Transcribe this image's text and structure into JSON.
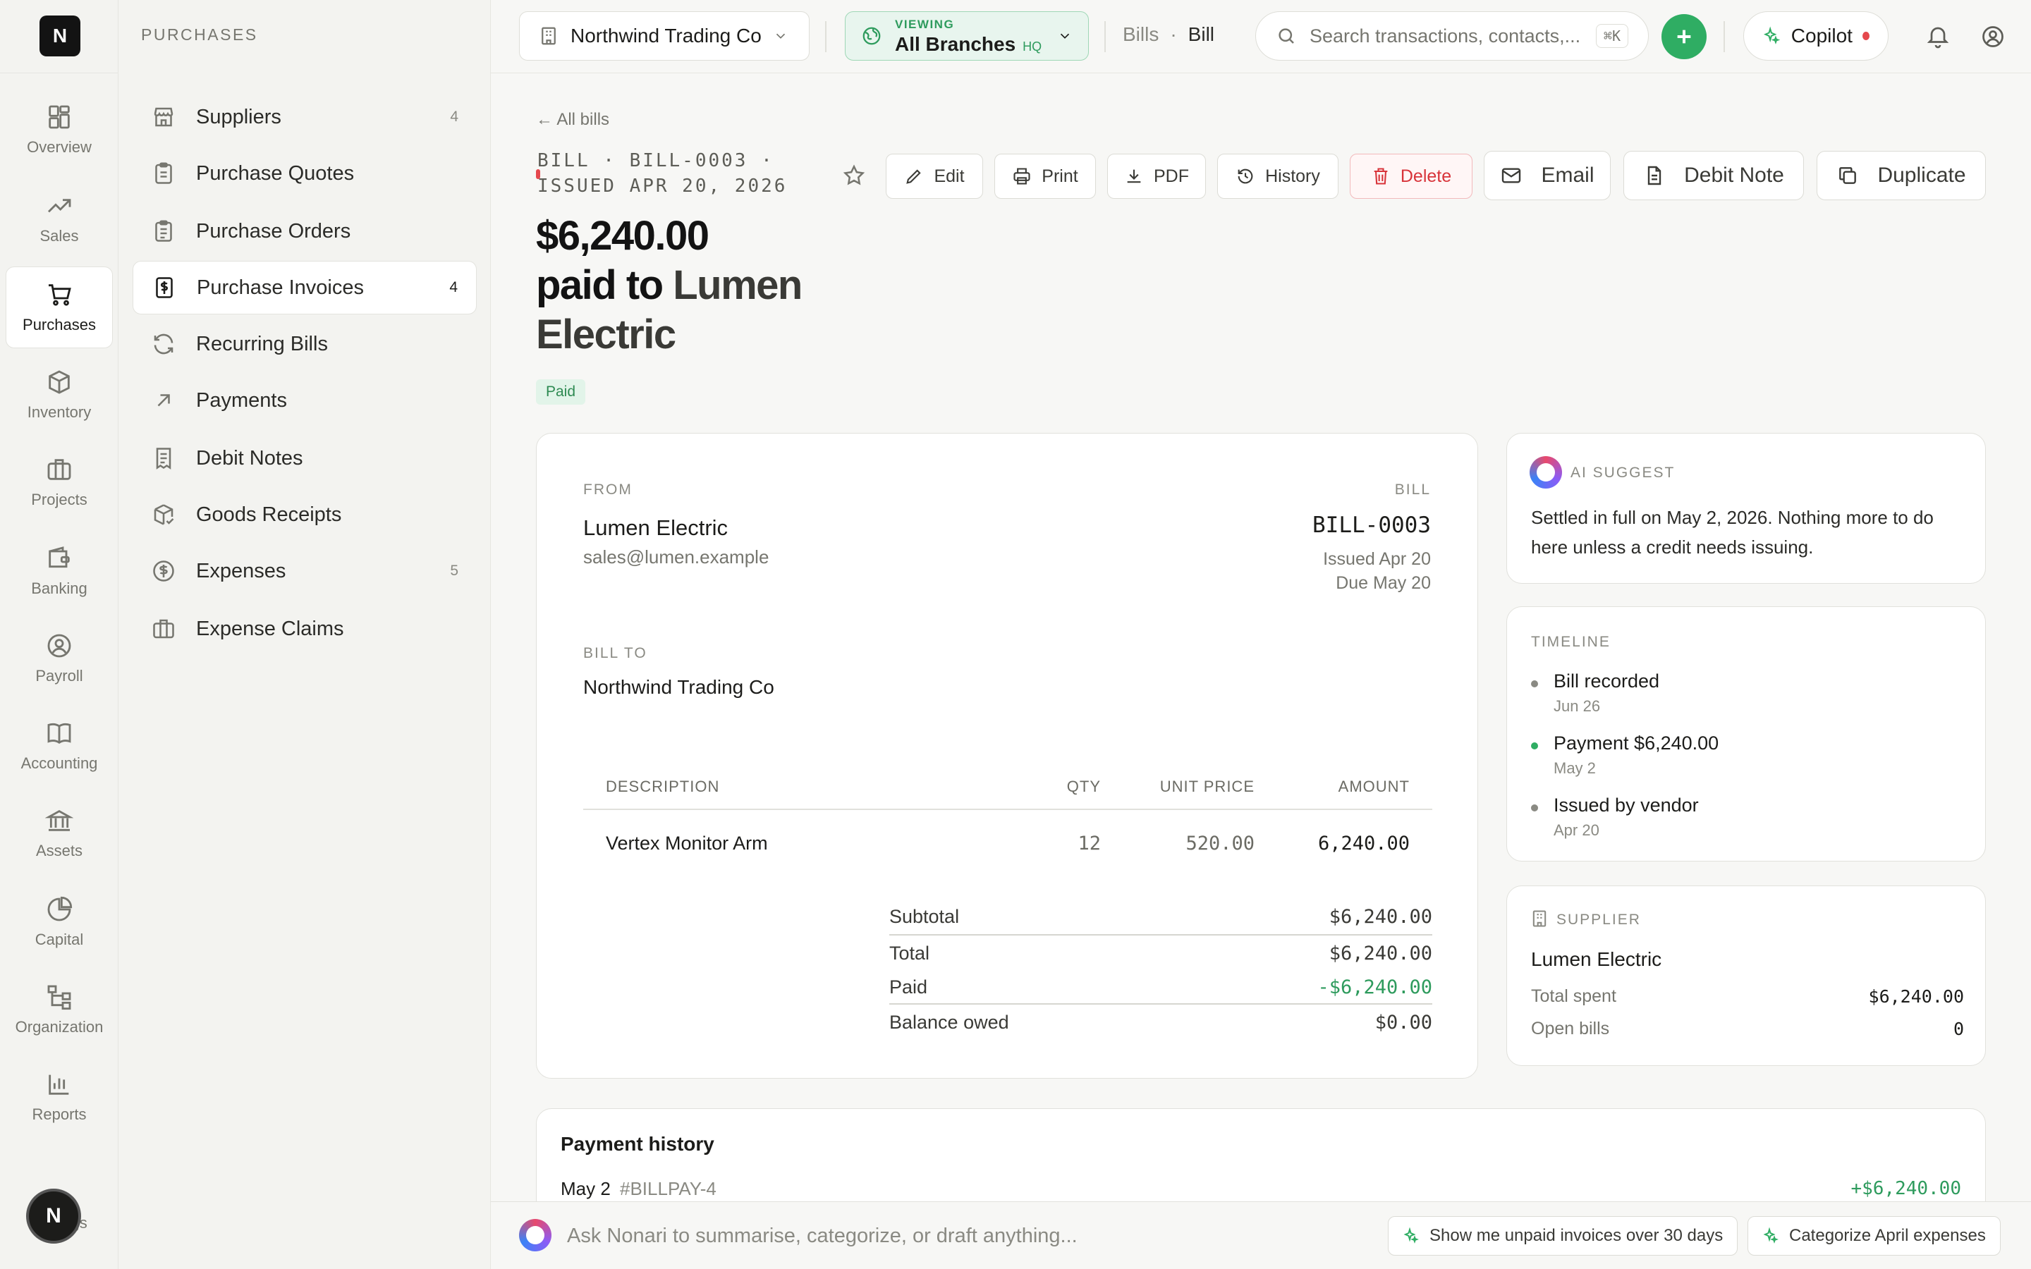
{
  "app": {
    "logo_letter": "N",
    "avatar_letter": "N",
    "hidden_rail_label": "Settings"
  },
  "rail": [
    {
      "label": "Overview",
      "icon": "grid-icon"
    },
    {
      "label": "Sales",
      "icon": "trend-icon"
    },
    {
      "label": "Purchases",
      "icon": "cart-icon",
      "active": true
    },
    {
      "label": "Inventory",
      "icon": "box-icon"
    },
    {
      "label": "Projects",
      "icon": "briefcase-icon"
    },
    {
      "label": "Banking",
      "icon": "wallet-icon"
    },
    {
      "label": "Payroll",
      "icon": "user-circle-icon"
    },
    {
      "label": "Accounting",
      "icon": "book-icon"
    },
    {
      "label": "Assets",
      "icon": "bank-icon"
    },
    {
      "label": "Capital",
      "icon": "pie-icon"
    },
    {
      "label": "Organization",
      "icon": "org-icon"
    },
    {
      "label": "Reports",
      "icon": "bar-chart-icon"
    }
  ],
  "subnav": {
    "title": "PURCHASES",
    "items": [
      {
        "label": "Suppliers",
        "count": "4",
        "icon": "store-icon"
      },
      {
        "label": "Purchase Quotes",
        "count": "",
        "icon": "clipboard-icon"
      },
      {
        "label": "Purchase Orders",
        "count": "",
        "icon": "clipboard-list-icon"
      },
      {
        "label": "Purchase Invoices",
        "count": "4",
        "icon": "dollar-doc-icon",
        "active": true
      },
      {
        "label": "Recurring Bills",
        "count": "",
        "icon": "refresh-icon"
      },
      {
        "label": "Payments",
        "count": "",
        "icon": "arrow-up-right-icon"
      },
      {
        "label": "Debit Notes",
        "count": "",
        "icon": "receipt-icon"
      },
      {
        "label": "Goods Receipts",
        "count": "",
        "icon": "package-check-icon"
      },
      {
        "label": "Expenses",
        "count": "5",
        "icon": "dollar-circle-icon"
      },
      {
        "label": "Expense Claims",
        "count": "",
        "icon": "briefcase-icon"
      }
    ]
  },
  "topbar": {
    "company": "Northwind Trading Co",
    "branch_label": "VIEWING",
    "branch_value": "All Branches",
    "branch_badge": "HQ",
    "breadcrumb": [
      "Bills",
      "·",
      "Bill"
    ],
    "search_placeholder": "Search transactions, contacts,...",
    "search_shortcut": "⌘K",
    "copilot_label": "Copilot"
  },
  "bill": {
    "back_link": "← All bills",
    "doc_id": "BILL · BILL-0003 · ISSUED APR 20, 2026",
    "amount": "$6,240.00",
    "paid_to_prefix": "paid to",
    "vendor": "Lumen Electric",
    "status": "Paid",
    "actions": {
      "edit": "Edit",
      "print": "Print",
      "pdf": "PDF",
      "history": "History",
      "delete": "Delete",
      "email": "Email",
      "debit_note": "Debit Note",
      "duplicate": "Duplicate"
    },
    "from_label": "FROM",
    "from_name": "Lumen Electric",
    "from_email": "sales@lumen.example",
    "bill_label": "BILL",
    "bill_number": "BILL-0003",
    "issued": "Issued Apr 20",
    "due": "Due May 20",
    "billto_label": "BILL TO",
    "billto_name": "Northwind Trading Co",
    "columns": {
      "description": "DESCRIPTION",
      "qty": "QTY",
      "unit_price": "UNIT PRICE",
      "amount": "AMOUNT"
    },
    "lines": [
      {
        "description": "Vertex Monitor Arm",
        "qty": "12",
        "unit_price": "520.00",
        "amount": "6,240.00"
      }
    ],
    "totals": {
      "subtotal_label": "Subtotal",
      "subtotal": "$6,240.00",
      "total_label": "Total",
      "total": "$6,240.00",
      "paid_label": "Paid",
      "paid": "-$6,240.00",
      "balance_label": "Balance owed",
      "balance": "$0.00"
    }
  },
  "ai_suggest": {
    "label": "AI SUGGEST",
    "text": "Settled in full on May 2, 2026. Nothing more to do here unless a credit needs issuing."
  },
  "timeline": {
    "label": "TIMELINE",
    "items": [
      {
        "title": "Bill recorded",
        "date": "Jun 26",
        "color": "gray"
      },
      {
        "title": "Payment $6,240.00",
        "date": "May 2",
        "color": "green"
      },
      {
        "title": "Issued by vendor",
        "date": "Apr 20",
        "color": "gray"
      }
    ]
  },
  "supplier": {
    "label": "SUPPLIER",
    "name": "Lumen Electric",
    "total_spent_label": "Total spent",
    "total_spent": "$6,240.00",
    "open_bills_label": "Open bills",
    "open_bills": "0"
  },
  "payment_history": {
    "title": "Payment history",
    "rows": [
      {
        "date": "May 2",
        "ref": "#BILLPAY-4",
        "amount": "+$6,240.00"
      }
    ]
  },
  "ask_bar": {
    "placeholder": "Ask Nonari to summarise, categorize, or draft anything...",
    "suggestions": [
      "Show me unpaid invoices over 30 days",
      "Categorize April expenses"
    ]
  },
  "colors": {
    "accent": "#2fad63",
    "danger": "#d8343a",
    "paid_badge_bg": "#e2f4e9"
  }
}
